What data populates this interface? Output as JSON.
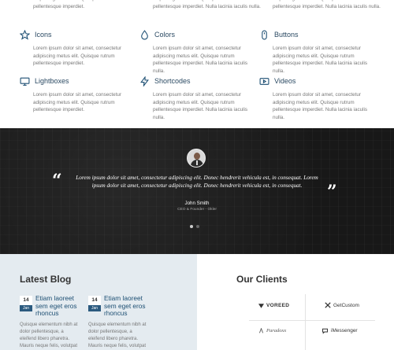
{
  "features": {
    "top_items": [
      {
        "desc": "adipiscing metus elit. Quisque rutrum pellentesque imperdiet."
      },
      {
        "desc": "adipiscing metus elit. Quisque rutrum pellentesque imperdiet. Nulla lacinia iaculis nulla."
      },
      {
        "desc": "adipiscing metus elit. Quisque rutrum pellentesque imperdiet. Nulla lacinia iaculis nulla."
      }
    ],
    "items": [
      {
        "icon": "star-icon",
        "title": "Icons",
        "desc": "Lorem ipsum dolor sit amet, consectetur adipiscing metus elit. Quisque rutrum pellentesque imperdiet."
      },
      {
        "icon": "drop-icon",
        "title": "Colors",
        "desc": "Lorem ipsum dolor sit amet, consectetur adipiscing metus elit. Quisque rutrum pellentesque imperdiet. Nulla lacinia iaculis nulla."
      },
      {
        "icon": "mouse-icon",
        "title": "Buttons",
        "desc": "Lorem ipsum dolor sit amet, consectetur adipiscing metus elit. Quisque rutrum pellentesque imperdiet. Nulla lacinia iaculis nulla."
      },
      {
        "icon": "desktop-icon",
        "title": "Lightboxes",
        "desc": "Lorem ipsum dolor sit amet, consectetur adipiscing metus elit. Quisque rutrum pellentesque imperdiet."
      },
      {
        "icon": "bolt-icon",
        "title": "Shortcodes",
        "desc": "Lorem ipsum dolor sit amet, consectetur adipiscing metus elit. Quisque rutrum pellentesque imperdiet. Nulla lacinia iaculis nulla."
      },
      {
        "icon": "video-icon",
        "title": "Videos",
        "desc": "Lorem ipsum dolor sit amet, consectetur adipiscing metus elit. Quisque rutrum pellentesque imperdiet. Nulla lacinia iaculis nulla."
      }
    ]
  },
  "testimonial": {
    "quote": "Lorem ipsum dolor sit amet, consectetur adipiscing elit. Donec hendrerit vehicula est, in consequat. Lorem ipsum dolor sit amet, consectetur adipiscing elit. Donec hendrerit vehicula est, in consequat.",
    "open_mark": "“",
    "close_mark": "”",
    "author": "John Smith",
    "role": "CEO & Founder - Okler",
    "slides": 2,
    "active_slide": 1
  },
  "blog": {
    "title_light": "Latest",
    "title_bold": "Blog",
    "posts": [
      {
        "day": "14",
        "month": "Jan",
        "title": "Etiam laoreet sem eget eros rhoncus",
        "desc": "Quisque elementum nibh at dolor pellentesque, a eleifend libero pharetra. Mauris neque felis, volutpat nec ullamcorper"
      },
      {
        "day": "14",
        "month": "Jan",
        "title": "Etiam laoreet sem eget eros rhoncus",
        "desc": "Quisque elementum nibh at dolor pellentesque, a eleifend libero pharetra. Mauris neque felis, volutpat nec ullamcorper"
      }
    ]
  },
  "clients": {
    "title_light": "Our",
    "title_bold": "Clients",
    "logos": [
      {
        "name": "VOREED",
        "icon": "voreed-logo-mark"
      },
      {
        "name": "GetCustom",
        "icon": "getcustom-logo-mark"
      },
      {
        "name": "Paradoxx",
        "icon": "paradoxx-logo-mark"
      },
      {
        "name": "iMessenger",
        "icon": "imessenger-logo-mark"
      }
    ]
  },
  "colors": {
    "accent": "#1d4f73",
    "dark_band": "#232425",
    "blog_bg": "#e4ebf0",
    "date_month_bg": "#2b5a7f"
  }
}
